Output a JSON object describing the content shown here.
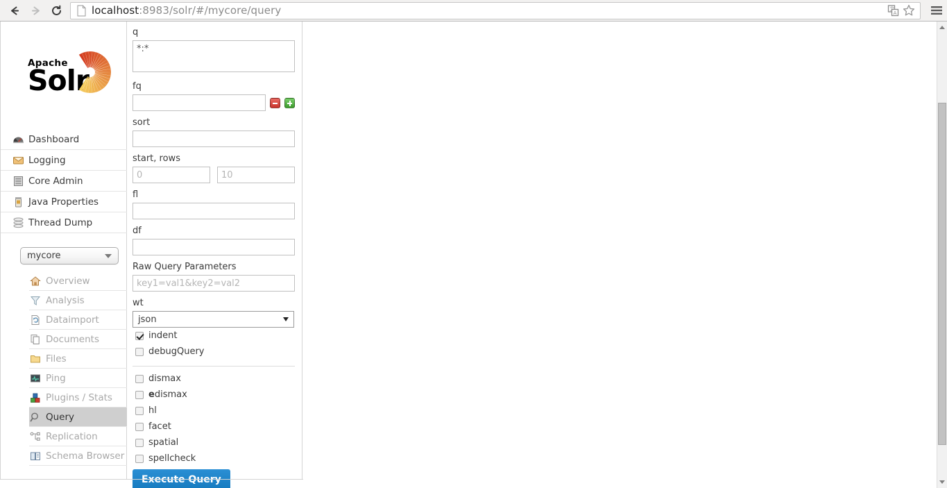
{
  "browser": {
    "back_title": "Back",
    "forward_title": "Forward",
    "reload_title": "Reload",
    "url_scheme_host": "localhost",
    "url_rest": ":8983/solr/#/mycore/query",
    "url_full": "localhost:8983/solr/#/mycore/query",
    "page_icon": "page-icon",
    "translate_icon": "translate-icon",
    "bookmark_icon": "star-icon",
    "menu_icon": "hamburger-menu-icon"
  },
  "sidebar": {
    "logo": {
      "line1": "Apache",
      "line2": "Solr"
    },
    "top_items": [
      {
        "label": "Dashboard",
        "icon": "dashboard-icon"
      },
      {
        "label": "Logging",
        "icon": "logging-icon"
      },
      {
        "label": "Core Admin",
        "icon": "core-admin-icon"
      },
      {
        "label": "Java Properties",
        "icon": "java-properties-icon"
      },
      {
        "label": "Thread Dump",
        "icon": "thread-dump-icon"
      }
    ],
    "core_selector": {
      "value": "mycore",
      "caret": "chevron-down-icon"
    },
    "core_items": [
      {
        "label": "Overview",
        "icon": "home-icon",
        "active": false
      },
      {
        "label": "Analysis",
        "icon": "funnel-icon",
        "active": false
      },
      {
        "label": "Dataimport",
        "icon": "dataimport-icon",
        "active": false
      },
      {
        "label": "Documents",
        "icon": "documents-icon",
        "active": false
      },
      {
        "label": "Files",
        "icon": "folder-icon",
        "active": false
      },
      {
        "label": "Ping",
        "icon": "ping-icon",
        "active": false
      },
      {
        "label": "Plugins / Stats",
        "icon": "plugins-icon",
        "active": false
      },
      {
        "label": "Query",
        "icon": "magnifier-icon",
        "active": true
      },
      {
        "label": "Replication",
        "icon": "replication-icon",
        "active": false
      },
      {
        "label": "Schema Browser",
        "icon": "schema-browser-icon",
        "active": false
      }
    ]
  },
  "query_form": {
    "q": {
      "label": "q",
      "value": "*:*"
    },
    "fq": {
      "label": "fq",
      "value": "",
      "remove_icon": "minus-icon",
      "add_icon": "plus-icon"
    },
    "sort": {
      "label": "sort",
      "value": ""
    },
    "start_rows": {
      "label": "start, rows",
      "start_placeholder": "0",
      "start_value": "",
      "rows_placeholder": "10",
      "rows_value": ""
    },
    "fl": {
      "label": "fl",
      "value": ""
    },
    "df": {
      "label": "df",
      "value": ""
    },
    "raw": {
      "label": "Raw Query Parameters",
      "placeholder": "key1=val1&key2=val2",
      "value": ""
    },
    "wt": {
      "label": "wt",
      "value": "json",
      "caret": "chevron-down-icon"
    },
    "toggles_primary": [
      {
        "label": "indent",
        "checked": true
      },
      {
        "label": "debugQuery",
        "checked": false
      }
    ],
    "toggles_secondary": [
      {
        "label": "dismax",
        "checked": false,
        "bold_prefix": ""
      },
      {
        "label": "dismax",
        "checked": false,
        "bold_prefix": "e"
      },
      {
        "label": "hl",
        "checked": false,
        "bold_prefix": ""
      },
      {
        "label": "facet",
        "checked": false,
        "bold_prefix": ""
      },
      {
        "label": "spatial",
        "checked": false,
        "bold_prefix": ""
      },
      {
        "label": "spellcheck",
        "checked": false,
        "bold_prefix": ""
      }
    ],
    "execute_label": "Execute Query"
  },
  "colors": {
    "accent_blue": "#1579be",
    "active_nav_bg": "#cfcfcf",
    "add_green": "#3d9b2c",
    "remove_red": "#c8332b",
    "logo_orange": "#e8762c"
  }
}
